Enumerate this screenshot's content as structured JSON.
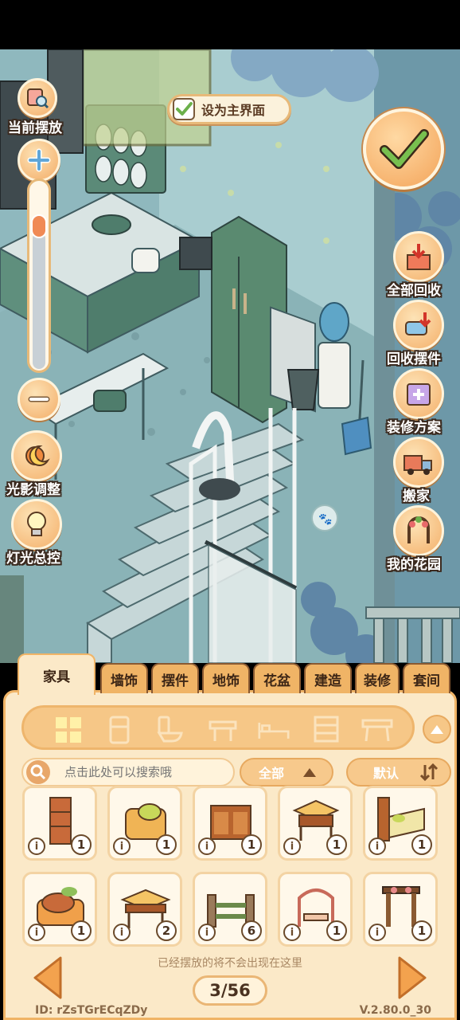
{
  "top": {
    "set_main_label": "设为主界面"
  },
  "left": {
    "current_place_label": "当前摆放",
    "light_shadow_label": "光影调整",
    "light_control_label": "灯光总控"
  },
  "right": {
    "recycle_all_label": "全部回收",
    "recycle_items_label": "回收摆件",
    "decor_plan_label": "装修方案",
    "move_label": "搬家",
    "garden_label": "我的花园"
  },
  "tabs": [
    {
      "label": "家具",
      "active": true
    },
    {
      "label": "墙饰"
    },
    {
      "label": "摆件"
    },
    {
      "label": "地饰"
    },
    {
      "label": "花盆"
    },
    {
      "label": "建造"
    },
    {
      "label": "装修"
    },
    {
      "label": "套间"
    }
  ],
  "categories": [
    "grid-icon",
    "fridge-icon",
    "toilet-icon",
    "table-icon",
    "bed-icon",
    "cabinet-icon",
    "desk-icon"
  ],
  "search": {
    "placeholder": "点击此处可以搜索哦"
  },
  "filter": {
    "all_label": "全部",
    "sort_label": "默认"
  },
  "items": [
    {
      "name": "bookshelf",
      "count": "1"
    },
    {
      "name": "armchair",
      "count": "1"
    },
    {
      "name": "sideboard",
      "count": "1"
    },
    {
      "name": "tea-table",
      "count": "1"
    },
    {
      "name": "bed",
      "count": "1"
    },
    {
      "name": "sofa",
      "count": "1"
    },
    {
      "name": "table",
      "count": "2"
    },
    {
      "name": "fence-gate",
      "count": "6"
    },
    {
      "name": "arch-bench",
      "count": "1"
    },
    {
      "name": "pergola",
      "count": "1"
    }
  ],
  "footer": {
    "hint": "已经摆放的将不会出现在这里",
    "page": "3/56",
    "user_id": "ID:  rZsTGrECqZDy",
    "version": "V.2.80.0_30"
  },
  "colors": {
    "accent": "#f3ad68",
    "panel_bg": "#fbe9c8",
    "scene_wall": "#9cc3c9",
    "label_outline": "#3b2a1f"
  }
}
